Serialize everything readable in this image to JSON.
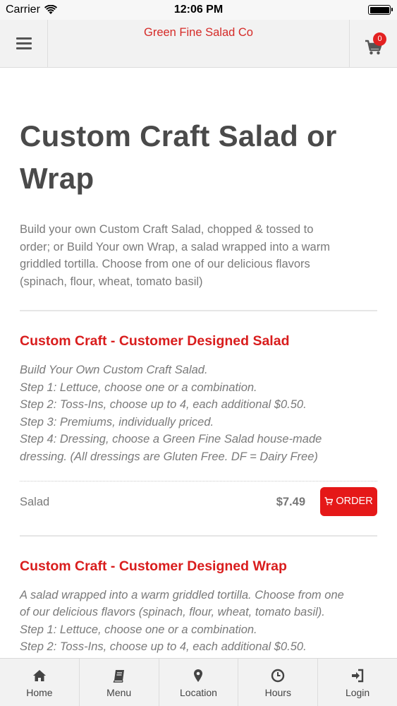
{
  "status_bar": {
    "carrier": "Carrier",
    "time": "12:06 PM"
  },
  "header": {
    "title": "Green Fine Salad Co",
    "cart_count": "0"
  },
  "page": {
    "title_line1": "Custom Craft Salad or",
    "title_line2": "Wrap",
    "description_lines": [
      "Build your own Custom Craft Salad, chopped & tossed to",
      "order; or Build Your own Wrap, a salad wrapped into a warm",
      "griddled tortilla. Choose from one of our delicious flavors",
      "(spinach, flour, wheat, tomato basil)"
    ]
  },
  "items": [
    {
      "title": "Custom Craft - Customer Designed Salad",
      "description_lines": [
        "Build Your Own Custom Craft Salad.",
        "Step 1: Lettuce, choose one or a combination.",
        "Step 2: Toss-Ins, choose up to 4, each additional $0.50.",
        "Step 3: Premiums, individually priced.",
        "Step 4: Dressing, choose a Green Fine Salad house-made",
        "dressing. (All dressings are Gluten Free. DF = Dairy Free)"
      ],
      "size": "Salad",
      "price": "$7.49",
      "order_label": "ORDER"
    },
    {
      "title": "Custom Craft - Customer Designed Wrap",
      "description_lines": [
        "A salad wrapped into a warm griddled tortilla. Choose from one",
        "of our delicious flavors (spinach, flour, wheat, tomato basil).",
        "Step 1: Lettuce, choose one or a combination.",
        "Step 2: Toss-Ins, choose up to 4, each additional $0.50."
      ]
    }
  ],
  "tab_bar": [
    {
      "label": "Home",
      "icon": "home-icon"
    },
    {
      "label": "Menu",
      "icon": "book-icon"
    },
    {
      "label": "Location",
      "icon": "map-marker-icon"
    },
    {
      "label": "Hours",
      "icon": "clock-icon"
    },
    {
      "label": "Login",
      "icon": "login-icon"
    }
  ],
  "colors": {
    "brand_red": "#d52a27",
    "order_button": "#e51818",
    "badge": "#e32121"
  }
}
